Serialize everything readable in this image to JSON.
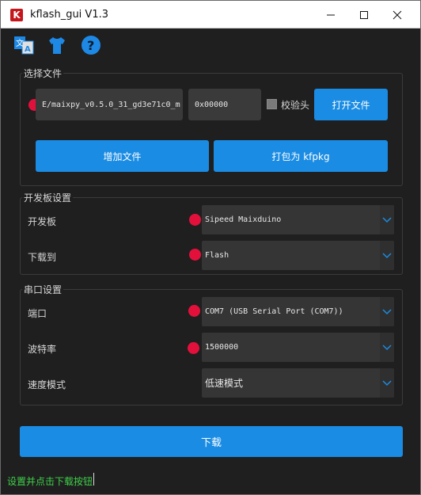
{
  "window": {
    "logo_letter": "K",
    "title": "kflash_gui V1.3",
    "minimize_glyph": "—",
    "maximize_glyph": "☐",
    "close_glyph": "✕"
  },
  "toolbar": {
    "icons": [
      "language-icon",
      "skin-icon",
      "help-icon"
    ]
  },
  "file_group": {
    "title": "选择文件",
    "file_path": "E/maixpy_v0.5.0_31_gd3e71c0_m",
    "address": "0x00000",
    "verify_label": "校验头",
    "verify_checked": false,
    "open_file_label": "打开文件",
    "add_file_label": "增加文件",
    "pack_label": "打包为 kfpkg"
  },
  "board_group": {
    "title": "开发板设置",
    "board_label": "开发板",
    "board_value": "Sipeed Maixduino",
    "download_to_label": "下载到",
    "download_to_value": "Flash"
  },
  "serial_group": {
    "title": "串口设置",
    "port_label": "端口",
    "port_value": "COM7 (USB Serial Port (COM7))",
    "baud_label": "波特率",
    "baud_value": "1500000",
    "speed_label": "速度模式",
    "speed_value": "低速模式"
  },
  "download_button": "下载",
  "status": "设置并点击下载按钮",
  "colors": {
    "accent": "#1a8ce3",
    "marker": "#e4103c",
    "status_text": "#3fd14a",
    "background": "#1f1f1f"
  }
}
